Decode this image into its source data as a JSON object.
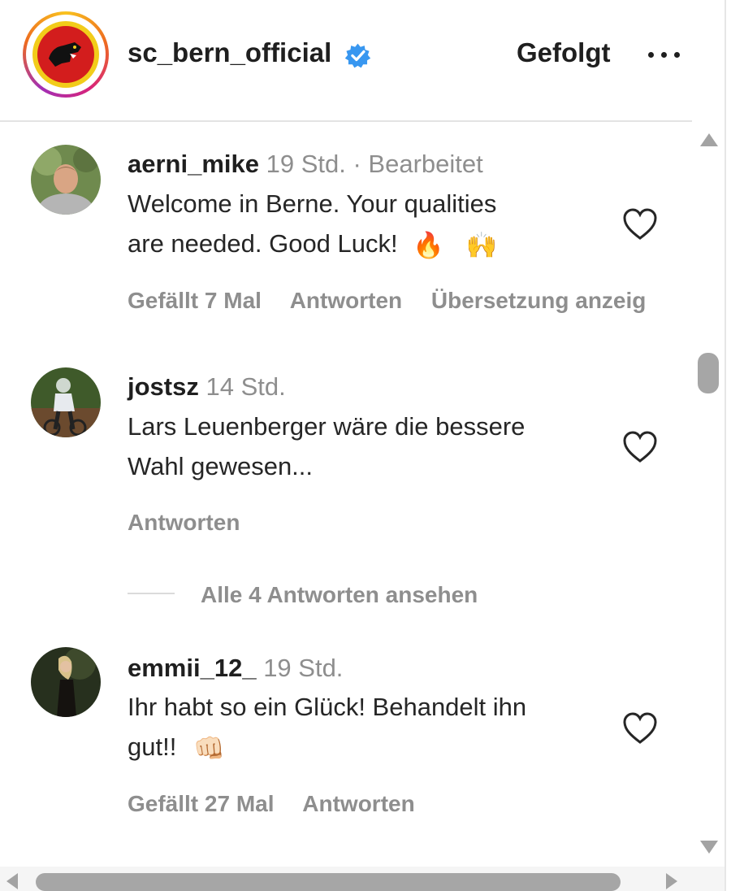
{
  "header": {
    "username": "sc_bern_official",
    "verified": true,
    "follow_label": "Gefolgt",
    "more_icon": "more-horizontal-icon",
    "logo_icon": "sc-bern-logo"
  },
  "comments": [
    {
      "username": "aerni_mike",
      "time": "19 Std.",
      "edited": "· Bearbeitet",
      "text_line1": "Welcome in Berne. Your qualities",
      "text_line2": "are needed. Good Luck!",
      "emoji1": "🔥",
      "emoji2": "🙌",
      "likes": "Gefällt 7 Mal",
      "reply": "Antworten",
      "translate": "Übersetzung anzeig"
    },
    {
      "username": "jostsz",
      "time": "14 Std.",
      "text_line1": "Lars Leuenberger wäre die bessere",
      "text_line2": "Wahl gewesen...",
      "reply": "Antworten",
      "view_replies": "Alle 4 Antworten ansehen"
    },
    {
      "username": "emmii_12_",
      "time": "19 Std.",
      "text_line1": "Ihr habt so ein Glück! Behandelt ihn",
      "text_line2": "gut!!",
      "emoji1": "👊🏻",
      "likes": "Gefällt 27 Mal",
      "reply": "Antworten"
    }
  ],
  "colors": {
    "verified": "#3897f0",
    "meta_text": "#8e8e8e",
    "primary_text": "#262626"
  }
}
